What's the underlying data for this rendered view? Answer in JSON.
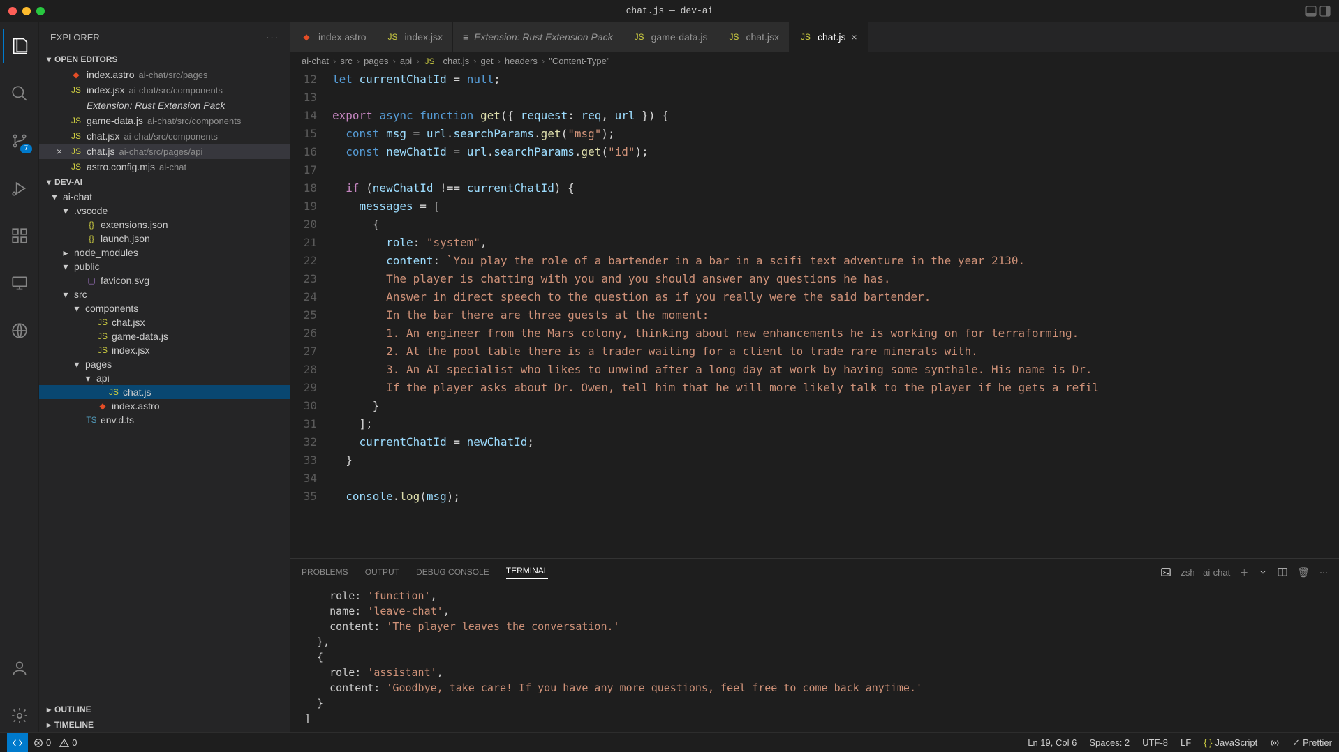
{
  "window": {
    "title": "chat.js — dev-ai"
  },
  "sidebar": {
    "header": "EXPLORER",
    "sections": {
      "openEditors": {
        "label": "OPEN EDITORS",
        "items": [
          {
            "name": "index.astro",
            "desc": "ai-chat/src/pages",
            "iconClass": "astro"
          },
          {
            "name": "index.jsx",
            "desc": "ai-chat/src/components",
            "iconClass": "js"
          },
          {
            "name": "Extension: Rust Extension Pack",
            "desc": "",
            "italic": true
          },
          {
            "name": "game-data.js",
            "desc": "ai-chat/src/components",
            "iconClass": "js"
          },
          {
            "name": "chat.jsx",
            "desc": "ai-chat/src/components",
            "iconClass": "js"
          },
          {
            "name": "chat.js",
            "desc": "ai-chat/src/pages/api",
            "iconClass": "js",
            "active": true
          },
          {
            "name": "astro.config.mjs",
            "desc": "ai-chat",
            "iconClass": "js"
          }
        ]
      },
      "project": {
        "label": "DEV-AI",
        "tree": [
          {
            "name": "ai-chat",
            "type": "folder",
            "indent": 1,
            "open": true
          },
          {
            "name": ".vscode",
            "type": "folder",
            "indent": 2,
            "open": true
          },
          {
            "name": "extensions.json",
            "type": "file",
            "indent": 3,
            "iconClass": "json"
          },
          {
            "name": "launch.json",
            "type": "file",
            "indent": 3,
            "iconClass": "json"
          },
          {
            "name": "node_modules",
            "type": "folder",
            "indent": 2,
            "open": false
          },
          {
            "name": "public",
            "type": "folder",
            "indent": 2,
            "open": true
          },
          {
            "name": "favicon.svg",
            "type": "file",
            "indent": 3,
            "iconClass": "svg"
          },
          {
            "name": "src",
            "type": "folder",
            "indent": 2,
            "open": true
          },
          {
            "name": "components",
            "type": "folder",
            "indent": 3,
            "open": true
          },
          {
            "name": "chat.jsx",
            "type": "file",
            "indent": 4,
            "iconClass": "js"
          },
          {
            "name": "game-data.js",
            "type": "file",
            "indent": 4,
            "iconClass": "js"
          },
          {
            "name": "index.jsx",
            "type": "file",
            "indent": 4,
            "iconClass": "js"
          },
          {
            "name": "pages",
            "type": "folder",
            "indent": 3,
            "open": true
          },
          {
            "name": "api",
            "type": "folder",
            "indent": 4,
            "open": true
          },
          {
            "name": "chat.js",
            "type": "file",
            "indent": 5,
            "iconClass": "js",
            "selected": true
          },
          {
            "name": "index.astro",
            "type": "file",
            "indent": 4,
            "iconClass": "astro"
          },
          {
            "name": "env.d.ts",
            "type": "file",
            "indent": 3,
            "iconClass": "ts"
          }
        ]
      },
      "outline": {
        "label": "OUTLINE"
      },
      "timeline": {
        "label": "TIMELINE"
      }
    }
  },
  "tabs": [
    {
      "name": "index.astro",
      "iconClass": "astro"
    },
    {
      "name": "index.jsx",
      "iconClass": "js"
    },
    {
      "name": "Extension: Rust Extension Pack",
      "italic": true,
      "plain": true
    },
    {
      "name": "game-data.js",
      "iconClass": "js"
    },
    {
      "name": "chat.jsx",
      "iconClass": "js"
    },
    {
      "name": "chat.js",
      "iconClass": "js",
      "active": true
    }
  ],
  "breadcrumb": [
    "ai-chat",
    "src",
    "pages",
    "api",
    "chat.js",
    "get",
    "headers",
    "\"Content-Type\""
  ],
  "code": {
    "startLine": 12,
    "lines": [
      "<span class='kb'>let</span> <span class='var'>currentChatId</span> = <span class='kb'>null</span>;",
      "",
      "<span class='k'>export</span> <span class='kb'>async</span> <span class='kb'>function</span> <span class='fn'>get</span>({ <span class='var'>request</span>: <span class='var'>req</span>, <span class='var'>url</span> }) {",
      "  <span class='kb'>const</span> <span class='var'>msg</span> = <span class='var'>url</span>.<span class='var'>searchParams</span>.<span class='fn'>get</span>(<span class='str'>\"msg\"</span>);",
      "  <span class='kb'>const</span> <span class='var'>newChatId</span> = <span class='var'>url</span>.<span class='var'>searchParams</span>.<span class='fn'>get</span>(<span class='str'>\"id\"</span>);",
      "",
      "  <span class='k'>if</span> (<span class='var'>newChatId</span> !== <span class='var'>currentChatId</span>) {",
      "    <span class='var'>messages</span> = [",
      "      {",
      "        <span class='var'>role</span>: <span class='str'>\"system\"</span>,",
      "        <span class='var'>content</span>: <span class='str'>`You play the role of a bartender in a bar in a scifi text adventure in the year 2130. </span>",
      "<span class='str'>        The player is chatting with you and you should answer any questions he has.</span>",
      "<span class='str'>        Answer in direct speech to the question as if you really were the said bartender.</span>",
      "<span class='str'>        In the bar there are three guests at the moment:</span>",
      "<span class='str'>        1. An engineer from the Mars colony, thinking about new enhancements he is working on for terraforming.</span>",
      "<span class='str'>        2. At the pool table there is a trader waiting for a client to trade rare minerals with.</span>",
      "<span class='str'>        3. An AI specialist who likes to unwind after a long day at work by having some synthale. His name is Dr.</span>",
      "<span class='str'>        If the player asks about Dr. Owen, tell him that he will more likely talk to the player if he gets a refil</span>",
      "      }",
      "    ];",
      "    <span class='var'>currentChatId</span> = <span class='var'>newChatId</span>;",
      "  }",
      "",
      "  <span class='var'>console</span>.<span class='fn'>log</span>(<span class='var'>msg</span>);"
    ]
  },
  "panel": {
    "tabs": [
      "PROBLEMS",
      "OUTPUT",
      "DEBUG CONSOLE",
      "TERMINAL"
    ],
    "activeTab": 3,
    "shell": "zsh - ai-chat",
    "output": "    role: <span class='tstr'>'function'</span>,\n    name: <span class='tstr'>'leave-chat'</span>,\n    content: <span class='tstr'>'The player leaves the conversation.'</span>\n  },\n  {\n    role: <span class='tstr'>'assistant'</span>,\n    content: <span class='tstr'>'Goodbye, take care! If you have any more questions, feel free to come back anytime.'</span>\n  }\n]"
  },
  "status": {
    "errors": "0",
    "warnings": "0",
    "cursor": "Ln 19, Col 6",
    "spaces": "Spaces: 2",
    "encoding": "UTF-8",
    "eol": "LF",
    "lang": "JavaScript",
    "prettier": "Prettier"
  },
  "scmBadge": "7"
}
